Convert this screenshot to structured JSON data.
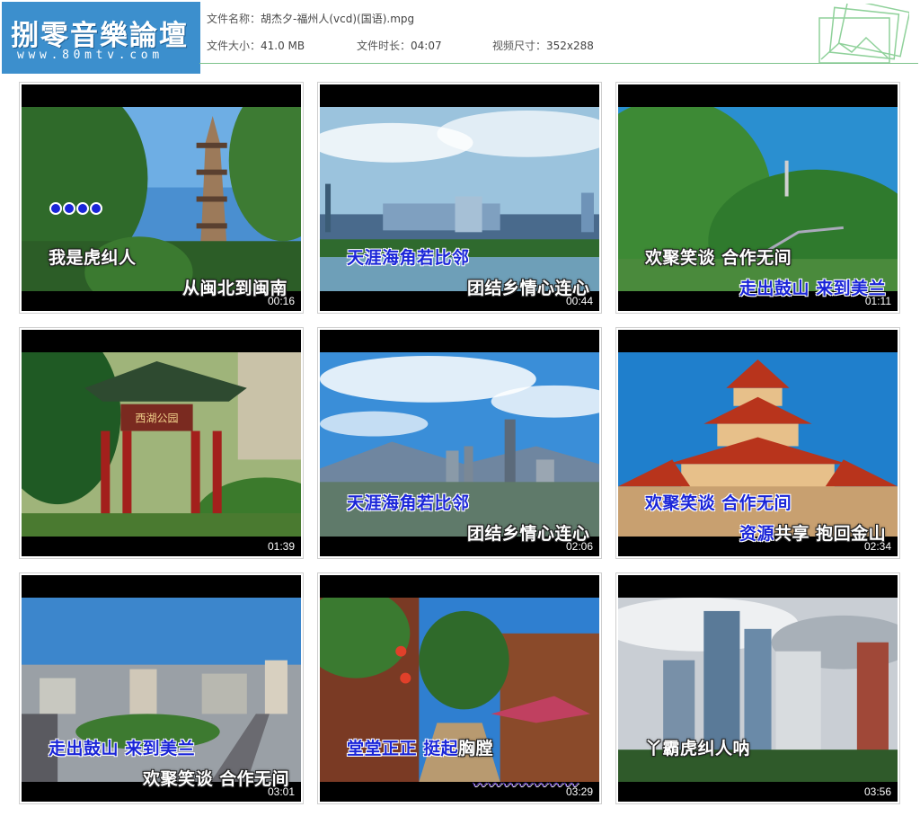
{
  "logo": {
    "title": "捌零音樂論壇",
    "url": "www.80mtv.com"
  },
  "file_info": {
    "name_label": "文件名称：",
    "name_value": "胡杰夕-福州人(vcd)(国语).mpg",
    "size_label": "文件大小：",
    "size_value": "41.0 MB",
    "duration_label": "文件时长：",
    "duration_value": "04:07",
    "dimensions_label": "视频尺寸：",
    "dimensions_value": "352x288"
  },
  "thumbnails": [
    {
      "time": "00:16",
      "lyric1": "我是虎纠人",
      "lyric2": "从闽北到闽南",
      "scene": "pagoda"
    },
    {
      "time": "00:44",
      "lyric1": "天涯海角若比邻",
      "lyric2": "团结乡情心连心",
      "scene": "waterfront"
    },
    {
      "time": "01:11",
      "lyric1": "欢聚笑谈  合作无间",
      "lyric2": "走出鼓山  来到美兰",
      "scene": "hill"
    },
    {
      "time": "01:39",
      "lyric1": "",
      "lyric2": "",
      "scene": "park-gate",
      "gate_sign": "西湖公园"
    },
    {
      "time": "02:06",
      "lyric1": "天涯海角若比邻",
      "lyric2": "团结乡情心连心",
      "scene": "skyline"
    },
    {
      "time": "02:34",
      "lyric1": "欢聚笑谈  合作无间",
      "lyric2a": "资源",
      "lyric2b": "共享  抱回金山",
      "scene": "temple"
    },
    {
      "time": "03:01",
      "lyric1": "走出鼓山  来到美兰",
      "lyric2": "欢聚笑谈  合作无间",
      "scene": "city"
    },
    {
      "time": "03:29",
      "lyric1a": "堂堂正正  挺起",
      "lyric1b": "胸膛",
      "lyric2": "",
      "scene": "street"
    },
    {
      "time": "03:56",
      "lyric1": "丫霸虎纠人呐",
      "lyric2": "",
      "scene": "towers"
    }
  ],
  "colors": {
    "header_blue": "#3c8fcd",
    "rule_green": "#7cc38b",
    "lyric_blue": "#1a25d8"
  }
}
